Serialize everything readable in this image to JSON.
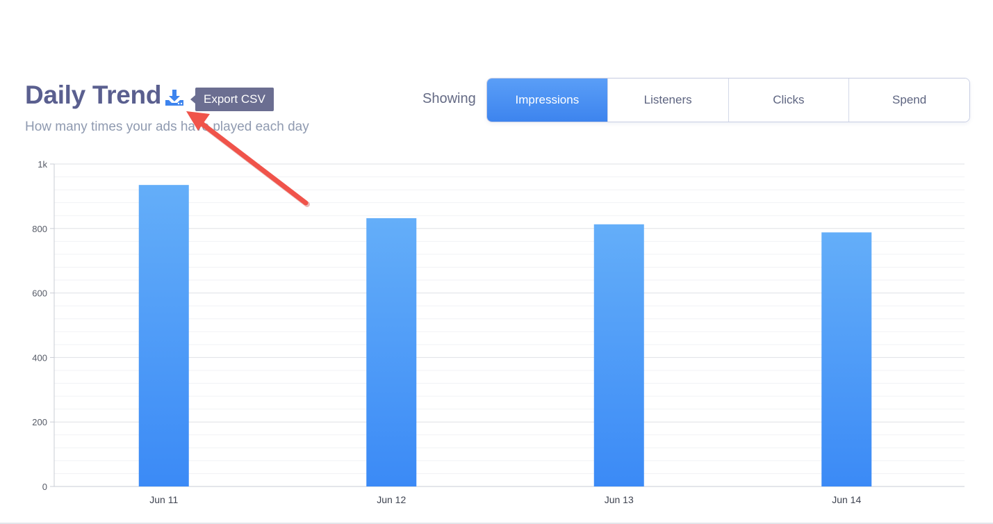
{
  "header": {
    "title": "Daily Trend",
    "subtitle": "How many times your ads have played each day",
    "export_tooltip": "Export CSV"
  },
  "icons": {
    "export": "download-icon"
  },
  "metric_selector": {
    "label": "Showing",
    "options": [
      "Impressions",
      "Listeners",
      "Clicks",
      "Spend"
    ],
    "selected": "Impressions"
  },
  "colors": {
    "accent": "#3d84ee",
    "bar_top": "#64aef9",
    "bar_bottom": "#3b8af6",
    "title": "#5a5f8f",
    "annotation_arrow": "#f0534a"
  },
  "chart_data": {
    "type": "bar",
    "categories": [
      "Jun 11",
      "Jun 12",
      "Jun 13",
      "Jun 14"
    ],
    "values": [
      935,
      832,
      813,
      788
    ],
    "yticks": [
      0,
      200,
      400,
      600,
      800,
      1000
    ],
    "ytick_labels": [
      "0",
      "200",
      "400",
      "600",
      "800",
      "1k"
    ],
    "ylim": [
      0,
      1000
    ],
    "grid": true
  }
}
